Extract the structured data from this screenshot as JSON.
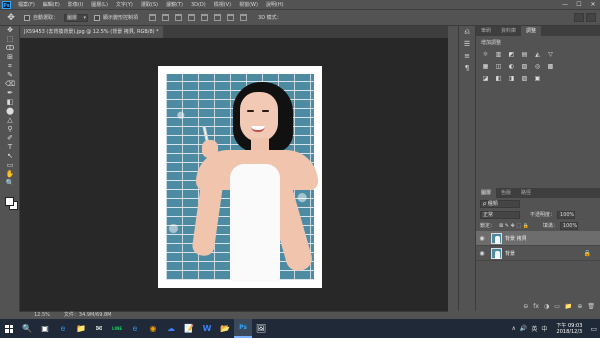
{
  "menubar": {
    "logo": "Ps",
    "items": [
      "檔案(F)",
      "編輯(E)",
      "影像(I)",
      "圖層(L)",
      "文字(Y)",
      "選取(S)",
      "濾鏡(T)",
      "3D(D)",
      "檢視(V)",
      "視窗(W)",
      "說明(H)"
    ],
    "controls": [
      "—",
      "☐",
      "✕"
    ]
  },
  "options": {
    "auto_select_label": "自動選取：",
    "auto_select_value": "圖層",
    "show_transform_label": "顯示變形控制項",
    "mode_3d_label": "3D 模式："
  },
  "document": {
    "tab_title": "JX59453 (去背換背景).jpg @ 12.5% (背景 拷貝, RGB/8) *"
  },
  "status": {
    "zoom": "12.5%",
    "doc_size": "文件：34.9M/69.8M"
  },
  "tools": [
    "✥",
    "⬚",
    "ↀ",
    "⊞",
    "⌗",
    "✎",
    "⌫",
    "✒",
    "◧",
    "⬤",
    "△",
    "⚲",
    "✐",
    "T",
    "↖",
    "▭",
    "✋",
    "🔍"
  ],
  "panels": {
    "top_tabs": [
      "筆刷",
      "資料庫",
      "調整"
    ],
    "adjust_title": "增加調整",
    "adjust_row1": [
      "☼",
      "▥",
      "◩",
      "▤",
      "◭",
      "▽"
    ],
    "adjust_row2": [
      "▦",
      "◫",
      "◐",
      "▧",
      "◎",
      "▩"
    ],
    "adjust_row3": [
      "◪",
      "◧",
      "◨",
      "▨",
      "▣"
    ]
  },
  "layers": {
    "tabs": [
      "圖層",
      "色版",
      "路徑"
    ],
    "filter_label": "ρ 種類",
    "blend_mode": "正常",
    "opacity_label": "不透明度：",
    "opacity_value": "100%",
    "lock_label": "鎖定：",
    "fill_label": "填滿：",
    "fill_value": "100%",
    "items": [
      {
        "name": "背景 拷貝",
        "active": true
      },
      {
        "name": "背景",
        "active": false
      }
    ],
    "bottom_icons": [
      "⊖",
      "fx",
      "◑",
      "▭",
      "📁",
      "⊕",
      "🗑"
    ]
  },
  "taskbar": {
    "apps": [
      "🔍",
      "▣",
      "e",
      "📁",
      "✉",
      "LINE",
      "e",
      "◉",
      "☁",
      "📝",
      "W",
      "📂",
      "Ps",
      "🖼"
    ],
    "tray": [
      "∧",
      "🔊",
      "英",
      "中"
    ],
    "time": "下午 09:03",
    "date": "2018/12/3"
  }
}
